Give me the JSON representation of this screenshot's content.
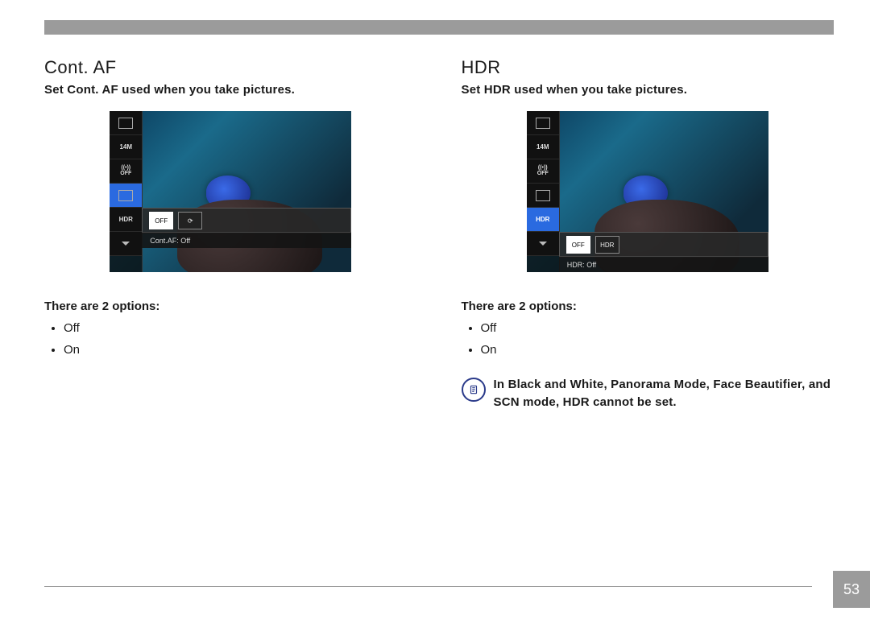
{
  "page_number": "53",
  "left": {
    "title": "Cont. AF",
    "subtitle": "Set Cont. AF used when you take pictures.",
    "ui_caption": "Cont.AF: Off",
    "side_labels": [
      "⌑",
      "14M",
      "Wi-Fi OFF",
      "AF OFF",
      "HDR OFF"
    ],
    "options_label": "There are 2 options:",
    "options": [
      "Off",
      "On"
    ]
  },
  "right": {
    "title": "HDR",
    "subtitle": "Set HDR used when you take pictures.",
    "ui_caption": "HDR: Off",
    "side_labels": [
      "⌑",
      "14M",
      "Wi-Fi OFF",
      "AF OFF",
      "HDR OFF"
    ],
    "options_label": "There are 2 options:",
    "options": [
      "Off",
      "On"
    ],
    "note": "In Black and White, Panorama Mode, Face Beautifier, and SCN mode, HDR cannot be set."
  }
}
